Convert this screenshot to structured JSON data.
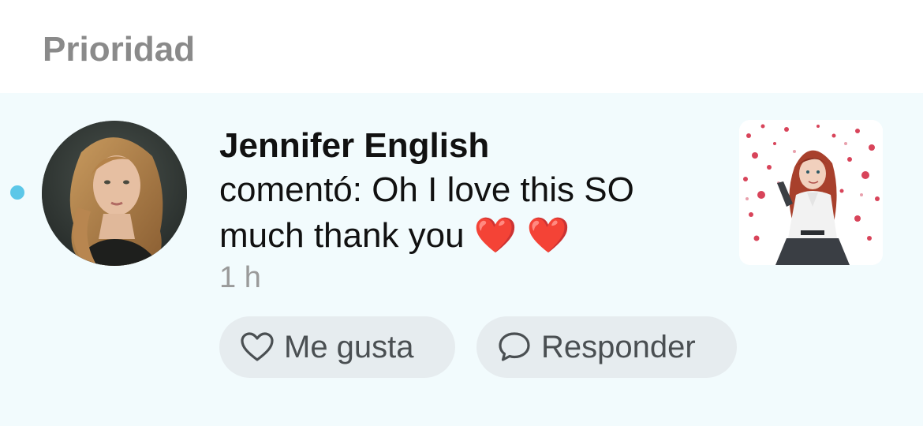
{
  "section": {
    "title": "Prioridad"
  },
  "notification": {
    "unread": true,
    "author": "Jennifer English",
    "message": "comentó: Oh I love this SO much thank you ❤️ ❤️",
    "timestamp": "1 h",
    "avatar_icon": "user-avatar",
    "thumbnail_icon": "post-thumbnail",
    "actions": {
      "like_label": "Me gusta",
      "like_icon": "heart-outline-icon",
      "reply_label": "Responder",
      "reply_icon": "speech-bubble-icon"
    }
  },
  "colors": {
    "section_title": "#8a8a8a",
    "notification_bg": "#f2fbfd",
    "unread_dot": "#5cc7e8",
    "button_bg": "#e6ecef",
    "timestamp": "#9a9a9a"
  }
}
